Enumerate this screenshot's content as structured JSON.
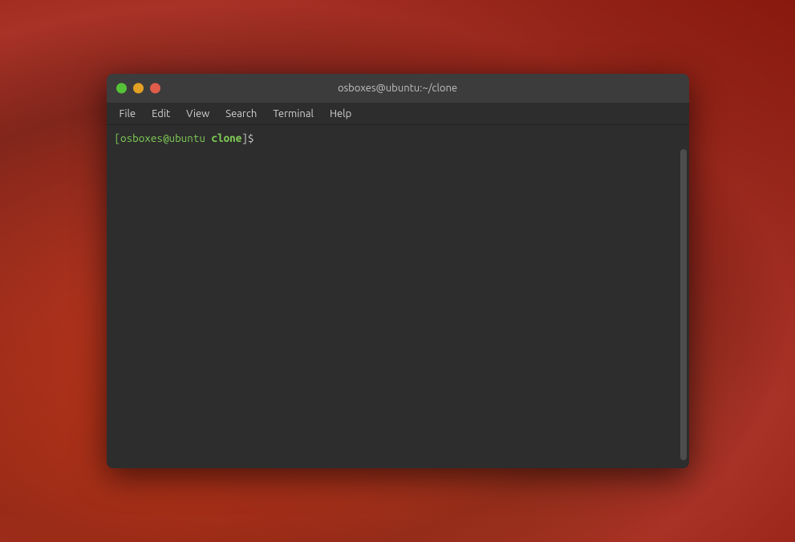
{
  "window": {
    "title": "osboxes@ubuntu:~/clone",
    "controls": {
      "green_label": "maximize",
      "yellow_label": "minimize",
      "red_label": "close"
    }
  },
  "menubar": {
    "items": [
      "File",
      "Edit",
      "View",
      "Search",
      "Terminal",
      "Help"
    ]
  },
  "terminal": {
    "prompt_user": "[osboxes@ubuntu",
    "prompt_path": "clone",
    "prompt_suffix": "]$"
  }
}
